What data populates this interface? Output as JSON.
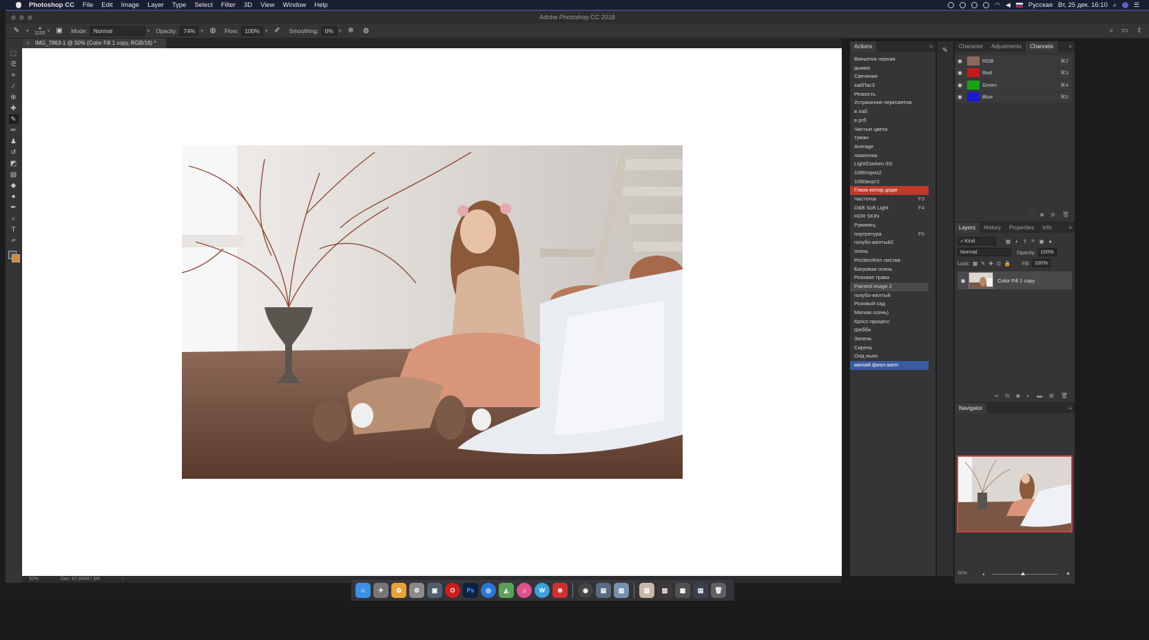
{
  "menubar": {
    "app_name": "Photoshop CC",
    "items": [
      "File",
      "Edit",
      "Image",
      "Layer",
      "Type",
      "Select",
      "Filter",
      "3D",
      "View",
      "Window",
      "Help"
    ],
    "language": "Русская",
    "datetime": "Вт, 25 дек.  16:10"
  },
  "window": {
    "title": "Adobe Photoshop CC 2018"
  },
  "options": {
    "brush_size": "1100",
    "mode_label": "Mode:",
    "mode_value": "Normal",
    "opacity_label": "Opacity:",
    "opacity_value": "74%",
    "flow_label": "Flow:",
    "flow_value": "100%",
    "smoothing_label": "Smoothing:",
    "smoothing_value": "0%"
  },
  "document": {
    "tab_title": "IMG_7863-1 @ 50% (Color Fill 1 copy, RGB/16) *",
    "zoom": "50%",
    "doc_size": "Doc: 87,6M/87,6M"
  },
  "actions": {
    "tab": "Actions",
    "items": [
      {
        "label": "Виньетка черная",
        "key": ""
      },
      {
        "label": "дымка",
        "key": ""
      },
      {
        "label": "Свечение",
        "key": ""
      },
      {
        "label": "хайПас3",
        "key": ""
      },
      {
        "label": "Резкость",
        "key": ""
      },
      {
        "label": "Устранение пересветов",
        "key": ""
      },
      {
        "label": "в лаб",
        "key": ""
      },
      {
        "label": "в ргб",
        "key": ""
      },
      {
        "label": "Чистые цвета",
        "key": ""
      },
      {
        "label": "туман",
        "key": ""
      },
      {
        "label": "Average",
        "key": ""
      },
      {
        "label": "лампочки",
        "key": ""
      },
      {
        "label": "Light/Darken SS",
        "key": ""
      },
      {
        "label": "1080гориз2",
        "key": ""
      },
      {
        "label": "1080верт2",
        "key": ""
      },
      {
        "label": "Глаза колор додж",
        "key": "",
        "state": "red"
      },
      {
        "label": "Частотка",
        "key": "F3"
      },
      {
        "label": "D&B Soft Light",
        "key": "F4"
      },
      {
        "label": "HDR SKIN",
        "key": ""
      },
      {
        "label": "Румянец",
        "key": ""
      },
      {
        "label": "портретура",
        "key": "F6"
      },
      {
        "label": "голубо-желтый2",
        "key": ""
      },
      {
        "label": "осень",
        "key": ""
      },
      {
        "label": "РозЗелЖел листва",
        "key": ""
      },
      {
        "label": "Багровая осень",
        "key": ""
      },
      {
        "label": "Розовая трава",
        "key": ""
      },
      {
        "label": "Painted image 2",
        "key": "",
        "state": "sel"
      },
      {
        "label": "голубо-желтый",
        "key": ""
      },
      {
        "label": "Розовый сад",
        "key": ""
      },
      {
        "label": "Мягкая осень)",
        "key": ""
      },
      {
        "label": "Кросс-процесс",
        "key": ""
      },
      {
        "label": "Шебби",
        "key": ""
      },
      {
        "label": "Зелень",
        "key": ""
      },
      {
        "label": "Сирень",
        "key": ""
      },
      {
        "label": "Олд ньюс",
        "key": ""
      },
      {
        "label": "мягкий фиол-желт",
        "key": "",
        "state": "blue"
      }
    ]
  },
  "channels_panel": {
    "tabs": [
      "Character",
      "Adjustments",
      "Channels"
    ],
    "active_tab": "Channels",
    "channels": [
      {
        "name": "RGB",
        "key": "⌘2",
        "color": "#8a6a5a"
      },
      {
        "name": "Red",
        "key": "⌘3",
        "color": "#c41a1a"
      },
      {
        "name": "Green",
        "key": "⌘4",
        "color": "#17a317"
      },
      {
        "name": "Blue",
        "key": "⌘5",
        "color": "#1a1ad0"
      }
    ]
  },
  "layers_panel": {
    "tabs": [
      "Layers",
      "History",
      "Properties",
      "Info"
    ],
    "active_tab": "Layers",
    "kind_label": "Kind",
    "blend_mode": "Normal",
    "opacity_label": "Opacity:",
    "opacity_value": "100%",
    "lock_label": "Lock:",
    "fill_label": "Fill:",
    "fill_value": "100%",
    "layers": [
      {
        "name": "Color Fill 1 copy"
      }
    ]
  },
  "navigator": {
    "title": "Navigator",
    "zoom": "50%"
  },
  "colors": {
    "selected_red": "#c0392b",
    "selected_blue": "#3a5ba0",
    "panel_bg": "#353537"
  }
}
